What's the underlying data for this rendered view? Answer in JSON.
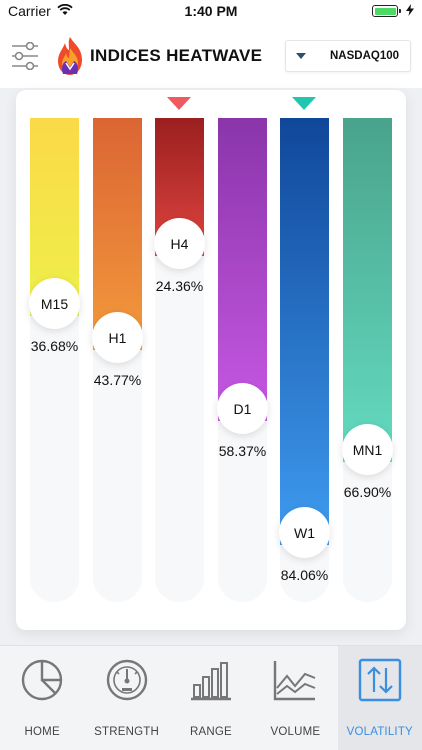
{
  "status_bar": {
    "carrier": "Carrier",
    "time": "1:40 PM"
  },
  "header": {
    "title": "INDICES HEATWAVE",
    "selected_index": "NASDAQ100"
  },
  "bars": [
    {
      "label": "M15",
      "percent_text": "36.68%",
      "value": 36.68,
      "gradient": [
        "#fbd948",
        "#eef04a"
      ]
    },
    {
      "label": "H1",
      "percent_text": "43.77%",
      "value": 43.77,
      "gradient": [
        "#db6533",
        "#f39a3c"
      ]
    },
    {
      "label": "H4",
      "percent_text": "24.36%",
      "value": 24.36,
      "gradient": [
        "#9b1f1f",
        "#e0453f"
      ],
      "marker": "#f0595f"
    },
    {
      "label": "D1",
      "percent_text": "58.37%",
      "value": 58.37,
      "gradient": [
        "#8a35aa",
        "#c758e3"
      ]
    },
    {
      "label": "W1",
      "percent_text": "84.06%",
      "value": 84.06,
      "gradient": [
        "#10479a",
        "#3f9cf0"
      ],
      "marker": "#1fc7b0"
    },
    {
      "label": "MN1",
      "percent_text": "66.90%",
      "value": 66.9,
      "gradient": [
        "#4aa38c",
        "#63dbc0"
      ]
    }
  ],
  "tabs": [
    {
      "label": "HOME",
      "icon": "pie-chart-icon",
      "active": false
    },
    {
      "label": "STRENGTH",
      "icon": "gauge-icon",
      "active": false
    },
    {
      "label": "RANGE",
      "icon": "bar-chart-icon",
      "active": false
    },
    {
      "label": "VOLUME",
      "icon": "line-chart-icon",
      "active": false
    },
    {
      "label": "VOLATILITY",
      "icon": "up-down-arrows-icon",
      "active": true
    }
  ],
  "colors": {
    "accent": "#3a8fe0"
  }
}
